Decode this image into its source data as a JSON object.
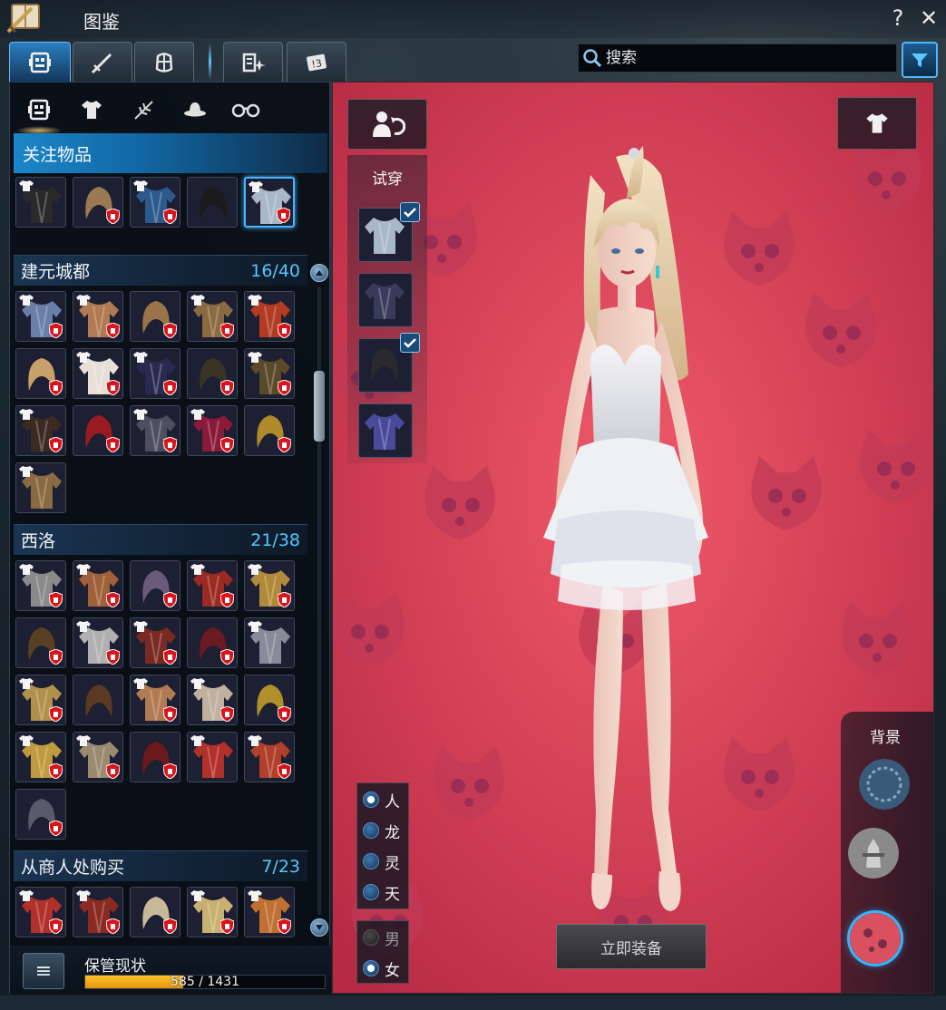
{
  "window": {
    "title": "图鉴",
    "help_label": "?",
    "close_label": "✕"
  },
  "search": {
    "placeholder": "搜索",
    "value": ""
  },
  "tabs": [
    {
      "name": "collection",
      "icon": "collection-icon",
      "active": true
    },
    {
      "name": "weapon",
      "icon": "sword-icon",
      "active": false
    },
    {
      "name": "armor",
      "icon": "armor-icon",
      "active": false
    },
    {
      "name": "outfit",
      "icon": "outfit-sparkle-icon",
      "active": false
    },
    {
      "name": "card",
      "icon": "card-icon",
      "active": false
    }
  ],
  "subtabs": [
    {
      "name": "all",
      "icon": "collection-icon",
      "active": true
    },
    {
      "name": "outfit",
      "icon": "shirt-icon",
      "active": false
    },
    {
      "name": "accessory",
      "icon": "feather-icon",
      "active": false
    },
    {
      "name": "hat",
      "icon": "hat-icon",
      "active": false
    },
    {
      "name": "glasses",
      "icon": "glasses-icon",
      "active": false
    }
  ],
  "favorites": {
    "title": "关注物品",
    "items": [
      {
        "kind": "outfit",
        "color": "#2a2a2a",
        "locked": false
      },
      {
        "kind": "hair",
        "color": "#9a7a52",
        "locked": true
      },
      {
        "kind": "outfit",
        "color": "#2c5a8c",
        "locked": true
      },
      {
        "kind": "hair",
        "color": "#1b1b1e",
        "locked": false
      },
      {
        "kind": "outfit",
        "color": "#a9b8c8",
        "locked": true,
        "selected": true
      }
    ]
  },
  "sections": [
    {
      "title": "建元城都",
      "count": "16/40",
      "items": [
        {
          "color": "#6a7fa8",
          "locked": true
        },
        {
          "color": "#b07a52",
          "locked": true
        },
        {
          "color": "#9a7448",
          "locked": true
        },
        {
          "color": "#8a6a40",
          "locked": true
        },
        {
          "color": "#b23b22",
          "locked": true
        },
        {
          "color": "#c9a06a",
          "locked": true
        },
        {
          "color": "#e8e0d8",
          "locked": true
        },
        {
          "color": "#2a2a50",
          "locked": true
        },
        {
          "color": "#3a3424",
          "locked": true
        },
        {
          "color": "#5a4a2a",
          "locked": true
        },
        {
          "color": "#3a2a22",
          "locked": true
        },
        {
          "color": "#9a1a22",
          "locked": true
        },
        {
          "color": "#4a5060",
          "locked": true
        },
        {
          "color": "#8a1a3a",
          "locked": true
        },
        {
          "color": "#b08a2a",
          "locked": true
        },
        {
          "color": "#8a6a42",
          "locked": false
        }
      ]
    },
    {
      "title": "西洛",
      "count": "21/38",
      "items": [
        {
          "color": "#8a8a8a",
          "locked": true
        },
        {
          "color": "#a0603a",
          "locked": true
        },
        {
          "color": "#6a5a7a",
          "locked": true
        },
        {
          "color": "#9a2a22",
          "locked": true
        },
        {
          "color": "#b08a3a",
          "locked": true
        },
        {
          "color": "#5a4022",
          "locked": true
        },
        {
          "color": "#b0b0b0",
          "locked": true
        },
        {
          "color": "#7a2a22",
          "locked": true
        },
        {
          "color": "#6a1a22",
          "locked": true
        },
        {
          "color": "#8a8a9a",
          "locked": false
        },
        {
          "color": "#b0904a",
          "locked": true
        },
        {
          "color": "#5a3a22",
          "locked": false
        },
        {
          "color": "#b07a52",
          "locked": true
        },
        {
          "color": "#c0b0a0",
          "locked": true
        },
        {
          "color": "#b0902a",
          "locked": true
        },
        {
          "color": "#c09a40",
          "locked": true
        },
        {
          "color": "#9a8a70",
          "locked": true
        },
        {
          "color": "#6a1a1a",
          "locked": true
        },
        {
          "color": "#b0302a",
          "locked": false
        },
        {
          "color": "#b0402a",
          "locked": true
        },
        {
          "color": "#5a5a6a",
          "locked": true
        }
      ]
    },
    {
      "title": "从商人处购买",
      "count": "7/23",
      "items": [
        {
          "color": "#b0302a",
          "locked": true
        },
        {
          "color": "#8a2a22",
          "locked": true
        },
        {
          "color": "#c8b89a",
          "locked": true
        },
        {
          "color": "#c8b070",
          "locked": true
        },
        {
          "color": "#c07030",
          "locked": true
        }
      ]
    }
  ],
  "storage": {
    "label": "保管现状",
    "menu_label": "≡",
    "current": 585,
    "total": 1431,
    "text": "585 / 1431"
  },
  "preview": {
    "tryon_label": "试穿",
    "tryon_slots": [
      {
        "kind": "outfit",
        "color": "#a9b8c8",
        "checked": true
      },
      {
        "kind": "accessory",
        "color": "#3a3a5a",
        "checked": false
      },
      {
        "kind": "hair",
        "color": "#2a2a2e",
        "checked": true
      },
      {
        "kind": "glasses",
        "color": "#4a4a9a",
        "checked": false
      }
    ],
    "races": [
      {
        "label": "人",
        "selected": true
      },
      {
        "label": "龙",
        "selected": false
      },
      {
        "label": "灵",
        "selected": false
      },
      {
        "label": "天",
        "selected": false
      }
    ],
    "genders": [
      {
        "label": "男",
        "selected": false,
        "disabled": true
      },
      {
        "label": "女",
        "selected": true,
        "disabled": false
      }
    ],
    "equip_label": "立即装备",
    "background_label": "背景",
    "backgrounds": [
      {
        "name": "pattern",
        "color": "#3a5a7a",
        "selected": false
      },
      {
        "name": "tower",
        "color": "#8a8a8a",
        "selected": false
      },
      {
        "name": "pink-cats",
        "color": "#d9505e",
        "selected": true
      }
    ],
    "bg_color": "#e54c60"
  }
}
